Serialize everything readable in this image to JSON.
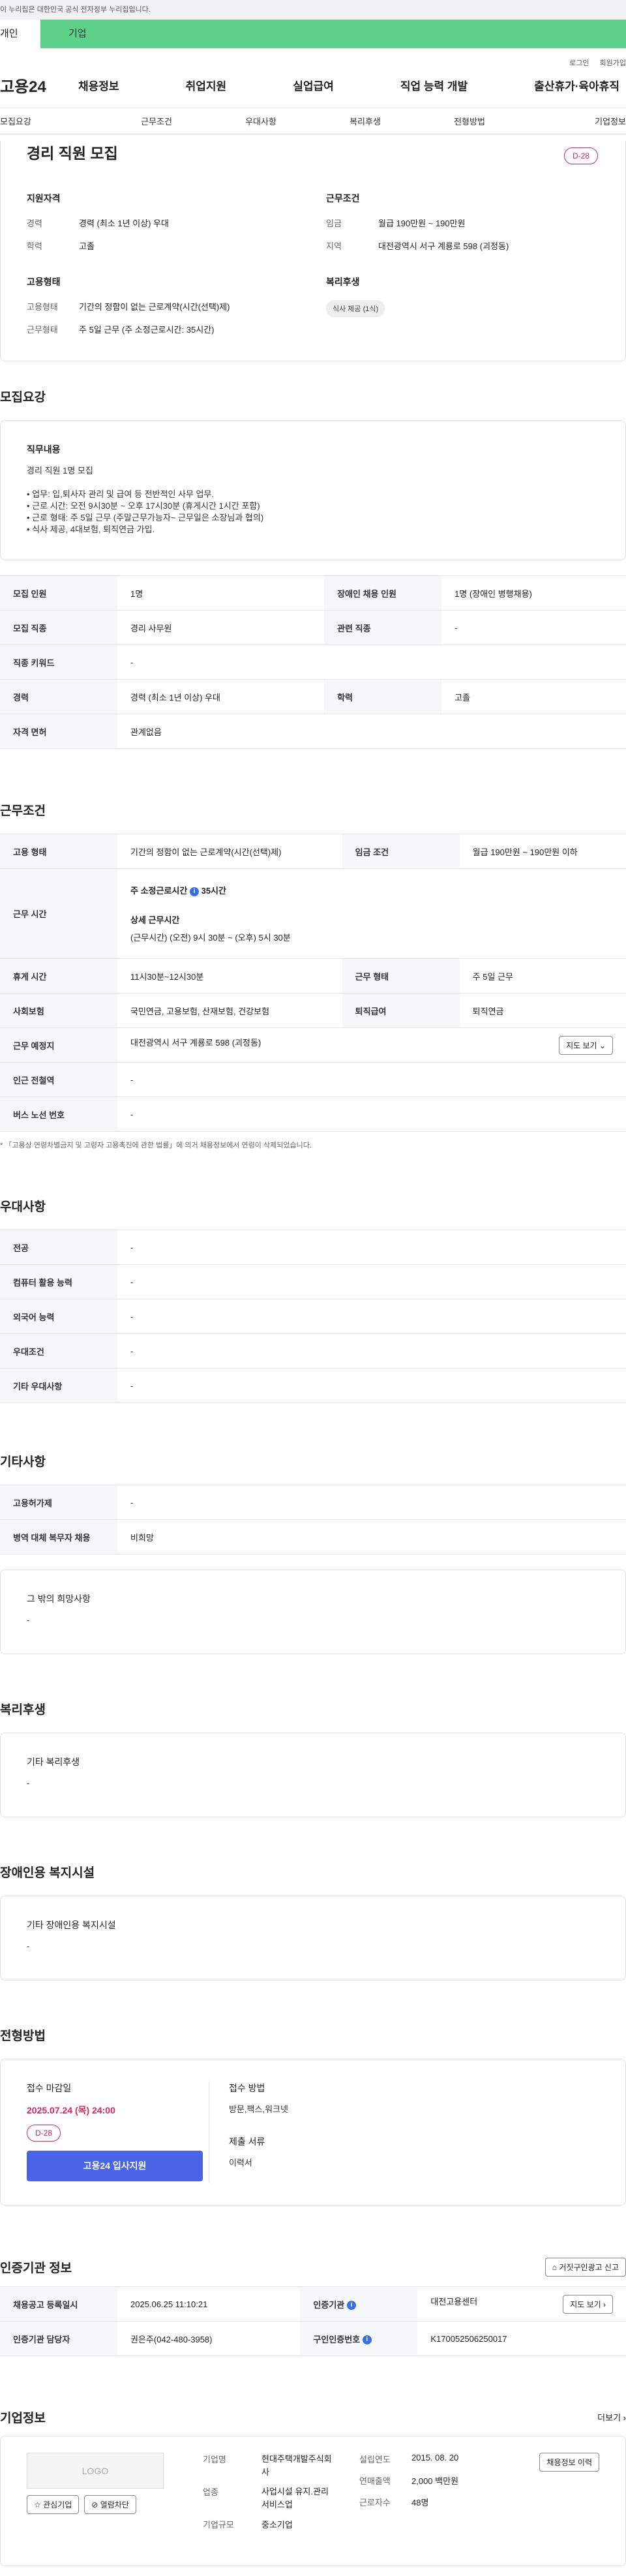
{
  "topbar": {
    "notice": "이 누리집은 대한민국 공식 전자정부 누리집입니다.",
    "tab_personal": "개인",
    "tab_company": "기업"
  },
  "util": {
    "login": "로그인",
    "join": "회원가입"
  },
  "header": {
    "logo": "고용24",
    "menu": [
      "채용정보",
      "취업지원",
      "실업급여",
      "직업 능력 개발",
      "출산휴가·육아휴직"
    ]
  },
  "snb": [
    "모집요강",
    "근무조건",
    "우대사항",
    "복리후생",
    "전형방법",
    "기업정보"
  ],
  "summary": {
    "title": "경리 직원 모집",
    "dday": "D-28",
    "qual_title": "지원자격",
    "career_k": "경력",
    "career_v": "경력 (최소 1년 이상) 우대",
    "edu_k": "학력",
    "edu_v": "고졸",
    "cond_title": "근무조건",
    "wage_k": "임금",
    "wage_v": "월급 190만원 ~ 190만원",
    "area_k": "지역",
    "area_v": "대전광역시 서구 계룡로 598 (괴정동)",
    "emp_title": "고용형태",
    "etype_k": "고용형태",
    "etype_v": "기간의 정함이 없는 근로계약(시간(선택)제)",
    "wform_k": "근무형태",
    "wform_v": "주 5일 근무 (주 소정근로시간: 35시간)",
    "welfare_title": "복리후생",
    "welfare_badge": "식사 제공 (1식)"
  },
  "recruit": {
    "title": "모집요강",
    "job_lbl": "직무내용",
    "job_name": "경리 직원 1명 모집",
    "lines": [
      "• 업무: 입,퇴사자 관리 및 급여 등 전반적인 사무 업무.",
      "• 근로 시간: 오전 9시30분 ~ 오후 17시30분 (휴게시간 1시간 포함)",
      "• 근로 형태: 주 5일 근무 (주말근무가능자~ 근무일은 소장님과 협의)",
      "• 식사 제공, 4대보험, 퇴직연금 가입."
    ],
    "rows": [
      {
        "k1": "모집 인원",
        "v1": "1명",
        "k2": "장애인 채용 인원",
        "v2": "1명 (장애인 병행채용)"
      },
      {
        "k1": "모집 직종",
        "v1": "경리 사무원",
        "k2": "관련 직종",
        "v2": "-"
      },
      {
        "k1": "직종 키워드",
        "v1": "-"
      },
      {
        "k1": "경력",
        "v1": "경력 (최소 1년 이상) 우대",
        "k2": "학력",
        "v2": "고졸"
      },
      {
        "k1": "자격 면허",
        "v1": "관계없음"
      }
    ]
  },
  "conditions": {
    "title": "근무조건",
    "etype_k": "고용 형태",
    "etype_v": "기간의 정함이 없는 근로계약(시간(선택)제)",
    "wage_k": "임금 조건",
    "wage_v": "월급 190만원 ~ 190만원 이하",
    "time_k": "근무 시간",
    "time_l1": "주 소정근로시간",
    "time_l1v": "35시간",
    "time_l2": "상세 근무시간",
    "time_l2v": "(근무시간) (오전) 9시 30분 ~ (오후) 5시 30분",
    "rest_k": "휴게 시간",
    "rest_v": "11시30분~12시30분",
    "wform_k": "근무 형태",
    "wform_v": "주 5일 근무",
    "ins_k": "사회보험",
    "ins_v": "국민연금, 고용보험, 산재보험, 건강보험",
    "ret_k": "퇴직급여",
    "ret_v": "퇴직연금",
    "place_k": "근무 예정지",
    "place_v": "대전광역시 서구 계룡로 598 (괴정동)",
    "map_btn": "지도 보기",
    "subway_k": "인근 전철역",
    "subway_v": "-",
    "bus_k": "버스 노선 번호",
    "bus_v": "-",
    "note": "* 「고용상 연령차별금지 및 고령자 고용촉진에 관한 법률」에 의거 채용정보에서 연령이 삭제되었습니다."
  },
  "prefer": {
    "title": "우대사항",
    "rows": [
      {
        "k": "전공",
        "v": "-"
      },
      {
        "k": "컴퓨터 활용 능력",
        "v": "-"
      },
      {
        "k": "외국어 능력",
        "v": "-"
      },
      {
        "k": "우대조건",
        "v": "-"
      },
      {
        "k": "기타 우대사항",
        "v": "-"
      }
    ]
  },
  "etc": {
    "title": "기타사항",
    "rows": [
      {
        "k": "고용허가제",
        "v": "-"
      },
      {
        "k": "병역 대체 복무자 채용",
        "v": "비희망"
      }
    ],
    "hope_lbl": "그 밖의 희망사항",
    "hope_v": "-"
  },
  "welfare": {
    "title": "복리후생",
    "lbl": "기타 복리후생",
    "v": "-"
  },
  "disabled": {
    "title": "장애인용 복지시설",
    "lbl": "기타 장애인용 복지시설",
    "v": "-"
  },
  "process": {
    "title": "전형방법",
    "deadline_lbl": "접수 마감일",
    "deadline": "2025.07.24 (목) 24:00",
    "dday": "D-28",
    "apply_btn": "고용24 입사지원",
    "method_lbl": "접수 방법",
    "method_v": "방문,팩스,워크넷",
    "docs_lbl": "제출 서류",
    "docs_v": "이력서"
  },
  "cert": {
    "title": "인증기관 정보",
    "report_btn": "거짓구인광고 신고",
    "reg_k": "채용공고 등록일시",
    "reg_v": "2025.06.25 11:10:21",
    "org_k": "인증기관",
    "org_v": "대전고용센터",
    "map_btn": "지도 보기",
    "mgr_k": "인증기관 담당자",
    "mgr_v": "권은주(042-480-3958)",
    "auth_k": "구인인증번호",
    "auth_v": "K170052506250017"
  },
  "company": {
    "title": "기업정보",
    "more": "더보기",
    "logo": "LOGO",
    "fav_btn": "관심기업",
    "block_btn": "열람차단",
    "hist_btn": "채용정보 이력",
    "name_k": "기업명",
    "name_v": "현대주택개발주식회사",
    "ind_k": "업종",
    "ind_v": "사업시설 유지.관리 서비스업",
    "size_k": "기업규모",
    "size_v": "중소기업",
    "est_k": "설립연도",
    "est_v": "2015. 08. 20",
    "sales_k": "연매출액",
    "sales_v": "2,000 백만원",
    "emp_k": "근로자수",
    "emp_v": "48명"
  }
}
